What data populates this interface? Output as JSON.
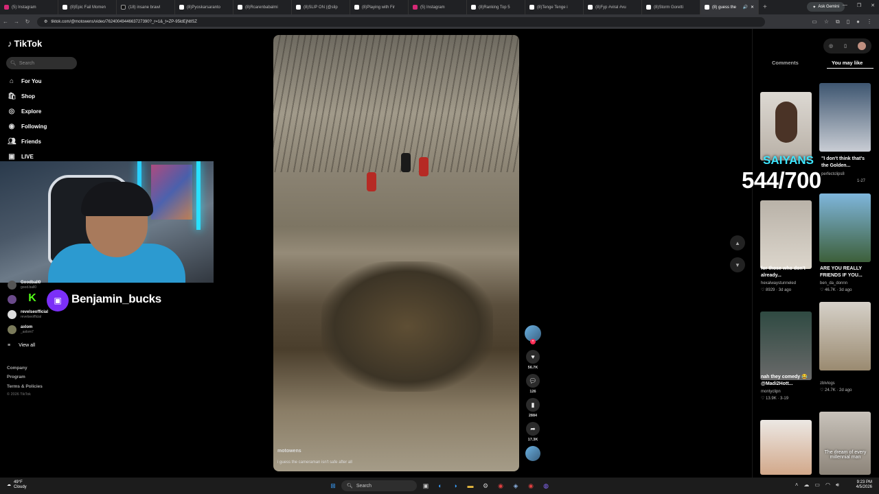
{
  "browser": {
    "tabs": [
      {
        "label": "(5) Instagram",
        "icon": "instagram-icon"
      },
      {
        "label": "(8)Epic Fail Momen",
        "icon": "tiktok-icon"
      },
      {
        "label": "(18) insane brawl",
        "icon": "x-icon"
      },
      {
        "label": "(8)Pyoskarsaranto",
        "icon": "tiktok-icon"
      },
      {
        "label": "(8)Rcarenbabalmi",
        "icon": "tiktok-icon"
      },
      {
        "label": "(8)SLIP ON (@slip",
        "icon": "tiktok-icon"
      },
      {
        "label": "(8)Playing with Fir",
        "icon": "tiktok-icon"
      },
      {
        "label": "(5) Instagram",
        "icon": "instagram-icon"
      },
      {
        "label": "(8)Ranking Top 5",
        "icon": "tiktok-icon"
      },
      {
        "label": "(8)Tenge Tenge i",
        "icon": "tiktok-icon"
      },
      {
        "label": "(8)Fyp #viral #vu",
        "icon": "tiktok-icon"
      },
      {
        "label": "(8)Storm Goretti",
        "icon": "tiktok-icon"
      },
      {
        "label": "(8) guess the",
        "icon": "tiktok-icon",
        "active": true
      }
    ],
    "gemini_label": "Ask Gemini",
    "url": "tiktok.com/@motowens/video/7624004944663727390?_r=1&_t=ZP-95ldEjNtlSZ"
  },
  "sidebar": {
    "brand": "TikTok",
    "search_placeholder": "Search",
    "nav": [
      {
        "label": "For You",
        "icon": "home-icon"
      },
      {
        "label": "Shop",
        "icon": "shop-icon"
      },
      {
        "label": "Explore",
        "icon": "compass-icon"
      },
      {
        "label": "Following",
        "icon": "avatar-icon"
      },
      {
        "label": "Friends",
        "icon": "friends-icon"
      },
      {
        "label": "LIVE",
        "icon": "live-icon"
      }
    ],
    "following": [
      {
        "name": "Goodball0",
        "handle": "good.ball0"
      },
      {
        "name": "revelseofficial",
        "handle": "revelseofficial"
      },
      {
        "name": "axlom",
        "handle": "_axlom7"
      }
    ],
    "view_all": "View all",
    "footer": [
      "Company",
      "Program",
      "Terms & Policies"
    ],
    "copyright": "© 2026 TikTok"
  },
  "stream": {
    "streamer_name": "Benjamin_bucks",
    "overlay_label": "SAIYANS",
    "overlay_count": "544/700"
  },
  "video": {
    "username": "motowens",
    "caption": "i guess the cameraman isn't safe after all",
    "likes": "56.7K",
    "comments": "126",
    "saves": "2884",
    "shares": "17.3K"
  },
  "panel": {
    "tabs": [
      "Comments",
      "You may like"
    ],
    "cards": [
      {
        "title": "",
        "author": "",
        "meta": ""
      },
      {
        "title": "\"I don't think that's the Golden...",
        "author": "perfectclips8",
        "meta": "1-27"
      },
      {
        "title": "for those who don't already...",
        "author": "hexalwaystunneled",
        "meta": "♡ 8929 · 3d ago"
      },
      {
        "title": "ARE YOU REALLY FRIENDS IF YOU...",
        "author": "ben_da_donnn",
        "meta": "♡ 46.7K · 3d ago"
      },
      {
        "title": "nah they comedy 😂 @Madi2Hott...",
        "author": "montyclipn",
        "meta": "♡ 13.9K · 3-19"
      },
      {
        "title": "",
        "author": "zblvlogs",
        "meta": "♡ 24.7K · 2d ago"
      },
      {
        "title": "",
        "author": "",
        "meta": ""
      },
      {
        "title": "The dream of every millennial man",
        "author": "",
        "meta": ""
      }
    ]
  },
  "taskbar": {
    "temp": "49°F",
    "weather": "Cloudy",
    "search_label": "Search",
    "time": "9:23 PM",
    "date": "4/5/2026"
  },
  "colors": {
    "accent": "#fe2c55",
    "twitch": "#7b2ff7",
    "kick": "#53fc18",
    "overlay": "#3ee6ff"
  }
}
